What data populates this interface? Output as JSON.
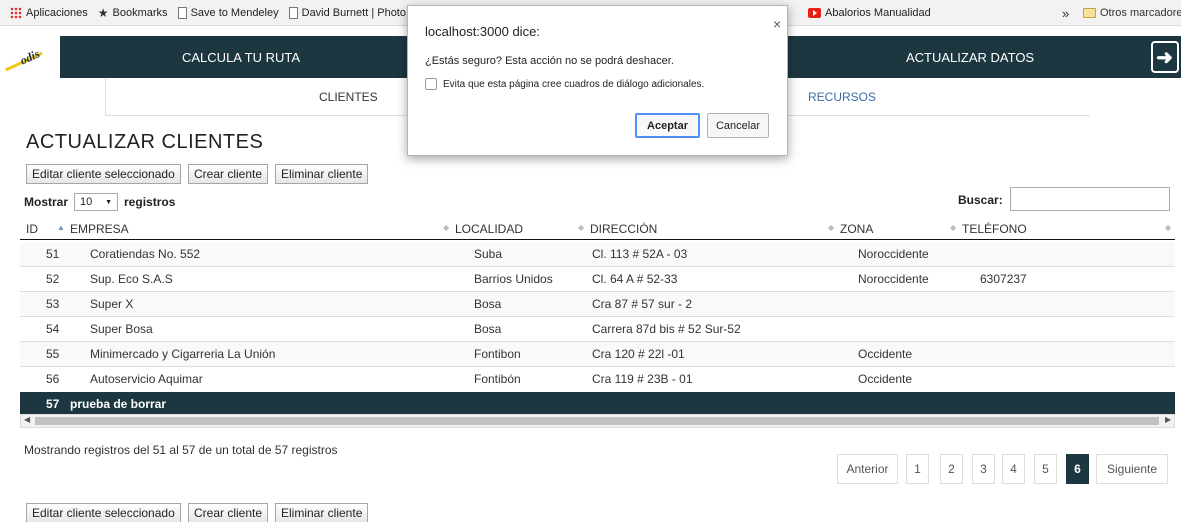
{
  "bookmarks": {
    "items": [
      "Aplicaciones",
      "Bookmarks",
      "Save to Mendeley",
      "David Burnett | Photo"
    ],
    "partial": "Abalorios Manualidad",
    "overflow": "»",
    "other_folder": "Otros marcadores"
  },
  "nav": {
    "logo": "odis",
    "calcula": "CALCULA TU RUTA",
    "actualizar": "ACTUALIZAR DATOS",
    "exit_icon": "exit-arrow-icon"
  },
  "subnav": {
    "clientes": "CLIENTES",
    "recursos": "RECURSOS"
  },
  "page": {
    "title": "ACTUALIZAR CLIENTES"
  },
  "buttons": {
    "edit": "Editar cliente seleccionado",
    "create": "Crear cliente",
    "delete": "Eliminar cliente"
  },
  "length": {
    "show": "Mostrar",
    "value": "10",
    "records": "registros"
  },
  "search": {
    "label": "Buscar:",
    "value": ""
  },
  "table": {
    "headers": [
      "ID",
      "EMPRESA",
      "LOCALIDAD",
      "DIRECCIÓN",
      "ZONA",
      "TELÉFONO"
    ],
    "rows": [
      {
        "id": "51",
        "empresa": "Coratiendas No. 552",
        "localidad": "Suba",
        "direccion": "Cl. 113 # 52A - 03",
        "zona": "Noroccidente",
        "telefono": ""
      },
      {
        "id": "52",
        "empresa": "Sup. Eco S.A.S",
        "localidad": "Barrios Unidos",
        "direccion": "Cl. 64 A # 52-33",
        "zona": "Noroccidente",
        "telefono": "6307237"
      },
      {
        "id": "53",
        "empresa": "Super X",
        "localidad": "Bosa",
        "direccion": "Cra 87 # 57 sur - 2",
        "zona": "",
        "telefono": ""
      },
      {
        "id": "54",
        "empresa": "Super Bosa",
        "localidad": "Bosa",
        "direccion": "Carrera 87d bis # 52 Sur-52",
        "zona": "",
        "telefono": ""
      },
      {
        "id": "55",
        "empresa": "Minimercado y Cigarreria La Unión",
        "localidad": "Fontibon",
        "direccion": "Cra 120 # 22l -01",
        "zona": "Occidente",
        "telefono": ""
      },
      {
        "id": "56",
        "empresa": "Autoservicio Aquimar",
        "localidad": "Fontibón",
        "direccion": "Cra 119 # 23B - 01",
        "zona": "Occidente",
        "telefono": ""
      },
      {
        "id": "57",
        "empresa": "prueba de borrar",
        "localidad": "",
        "direccion": "",
        "zona": "",
        "telefono": ""
      }
    ]
  },
  "info": "Mostrando registros del 51 al 57 de un total de 57 registros",
  "pagination": {
    "prev": "Anterior",
    "pages": [
      "1",
      "2",
      "3",
      "4",
      "5",
      "6"
    ],
    "active": "6",
    "next": "Siguiente"
  },
  "dialog": {
    "title": "localhost:3000 dice:",
    "close": "×",
    "message": "¿Estás seguro? Esta acción no se podrá deshacer.",
    "checkbox": "Evita que esta página cree cuadros de diálogo adicionales.",
    "accept": "Aceptar",
    "cancel": "Cancelar"
  },
  "colors": {
    "nav_bg": "#1d3741",
    "selected_row": "#1d3741",
    "dialog_focus": "#4d90fe"
  }
}
